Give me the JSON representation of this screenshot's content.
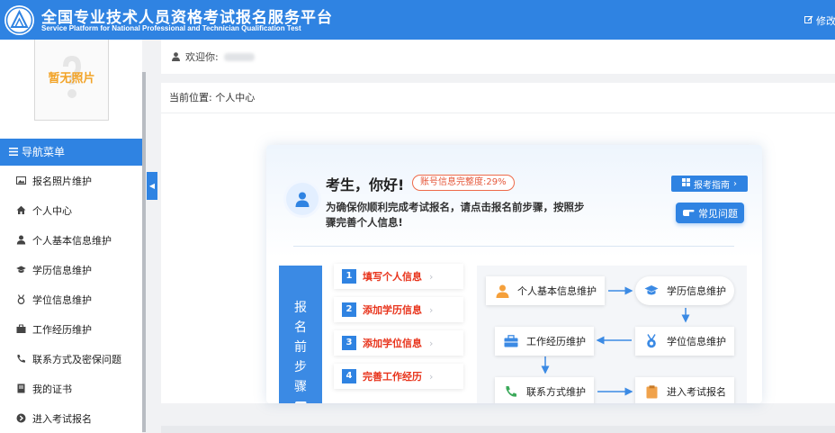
{
  "header": {
    "title": "全国专业技术人员资格考试报名服务平台",
    "subtitle": "Service Platform for National Professional and Technician Qualification Test",
    "modify_label": "修改"
  },
  "sidebar": {
    "photo_placeholder": "暂无照片",
    "nav_title": "导航菜单",
    "items": [
      {
        "label": "报名照片维护",
        "icon": "image-icon"
      },
      {
        "label": "个人中心",
        "icon": "home-icon"
      },
      {
        "label": "个人基本信息维护",
        "icon": "user-icon"
      },
      {
        "label": "学历信息维护",
        "icon": "graduation-cap-icon"
      },
      {
        "label": "学位信息维护",
        "icon": "medal-icon"
      },
      {
        "label": "工作经历维护",
        "icon": "briefcase-icon"
      },
      {
        "label": "联系方式及密保问题",
        "icon": "phone-icon"
      },
      {
        "label": "我的证书",
        "icon": "book-icon"
      },
      {
        "label": "进入考试报名",
        "icon": "arrow-circle-icon"
      }
    ]
  },
  "welcome": {
    "label": "欢迎你:"
  },
  "breadcrumb": {
    "prefix": "当前位置:",
    "current": "个人中心"
  },
  "card": {
    "greeting": "考生，你好!",
    "completion": "账号信息完整度:29%",
    "intro": "为确保你顺利完成考试报名，请点击报名前步骤，按照步骤完善个人信息!",
    "guide_button": "报考指南",
    "faq_button": "常见问题",
    "steps_title": [
      "报",
      "名",
      "前",
      "步",
      "骤"
    ],
    "steps": [
      {
        "num": "1",
        "label": "填写个人信息"
      },
      {
        "num": "2",
        "label": "添加学历信息"
      },
      {
        "num": "3",
        "label": "添加学位信息"
      },
      {
        "num": "4",
        "label": "完善工作经历"
      }
    ],
    "flow": {
      "personal": "个人基本信息维护",
      "education": "学历信息维护",
      "degree": "学位信息维护",
      "work": "工作经历维护",
      "contact": "联系方式维护",
      "enroll": "进入考试报名"
    }
  },
  "colors": {
    "primary": "#2f83e2",
    "accent_red": "#e8341c",
    "photo_text": "#f2a327"
  }
}
